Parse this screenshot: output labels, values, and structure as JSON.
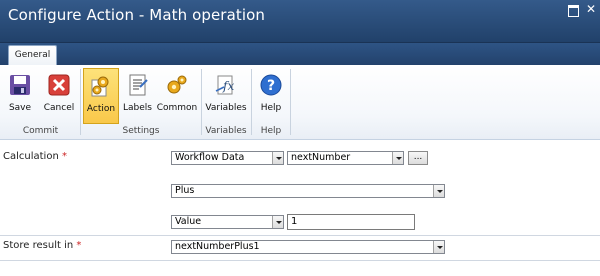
{
  "window": {
    "title": "Configure Action - Math operation"
  },
  "tabs": [
    {
      "label": "General"
    }
  ],
  "ribbon": {
    "buttons": {
      "save": "Save",
      "cancel": "Cancel",
      "action": "Action",
      "labels": "Labels",
      "common": "Common",
      "variables": "Variables",
      "help": "Help"
    },
    "groups": {
      "commit": "Commit",
      "settings": "Settings",
      "variables": "Variables",
      "help": "Help"
    }
  },
  "form": {
    "calculation": {
      "label": "Calculation",
      "required_mark": "*",
      "source_type": "Workflow Data",
      "source_value": "nextNumber",
      "browse_label": "...",
      "operator": "Plus",
      "operand_type": "Value",
      "operand_value": "1"
    },
    "store_result": {
      "label": "Store result in",
      "required_mark": "*",
      "value": "nextNumberPlus1"
    }
  },
  "colors": {
    "title_bar": "#2a4c7a",
    "active_button": "#f9c84a",
    "required": "#cc2222"
  }
}
